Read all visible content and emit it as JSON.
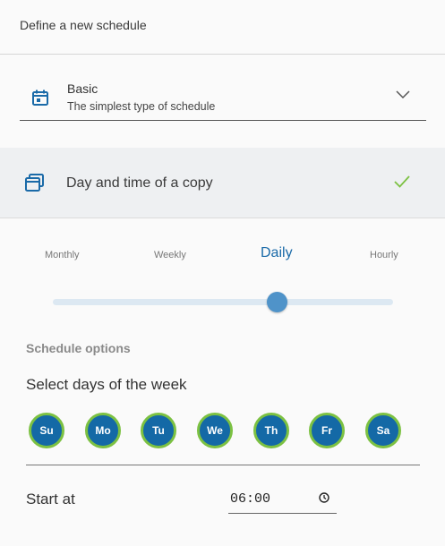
{
  "header": {
    "title": "Define a new schedule"
  },
  "schedule_type": {
    "name": "Basic",
    "description": "The simplest type of schedule",
    "icon": "calendar-icon"
  },
  "section": {
    "title": "Day and time of a copy",
    "icon": "copies-icon",
    "status_icon": "check-icon"
  },
  "frequency": {
    "options": [
      "Monthly",
      "Weekly",
      "Daily",
      "Hourly"
    ],
    "selected": "Daily",
    "slider_position_percent": 66
  },
  "options": {
    "heading": "Schedule options",
    "days_label": "Select days of the week",
    "days": [
      "Su",
      "Mo",
      "Tu",
      "We",
      "Th",
      "Fr",
      "Sa"
    ]
  },
  "start": {
    "label": "Start at",
    "time": "06:00"
  },
  "colors": {
    "accent": "#1a6aa8",
    "day_fill": "#1469a6",
    "day_ring": "#7cc142",
    "check": "#7cc142",
    "slider_track": "#dce8f2",
    "slider_thumb": "#4f93c9"
  }
}
